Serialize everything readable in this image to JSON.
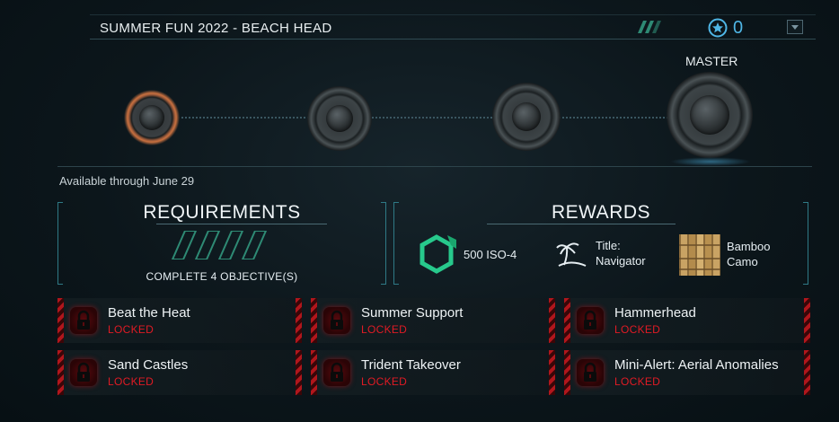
{
  "header": {
    "title": "SUMMER FUN 2022 - BEACH HEAD",
    "star_count": "0",
    "colors": {
      "accent": "#4fb6e6",
      "stripe": "#2e8a74"
    }
  },
  "tiers": {
    "master_label": "MASTER",
    "items": [
      {
        "name": "tier-1",
        "state": "active"
      },
      {
        "name": "tier-2",
        "state": "inactive"
      },
      {
        "name": "tier-3",
        "state": "inactive"
      },
      {
        "name": "tier-master",
        "state": "inactive"
      }
    ]
  },
  "availability": "Available through June 29",
  "requirements": {
    "title": "REQUIREMENTS",
    "objective_count": "COMPLETE 4 OBJECTIVE(S)",
    "progress_total": 4,
    "progress_done": 0
  },
  "rewards": {
    "title": "REWARDS",
    "items": [
      {
        "icon": "iso-crystal-icon",
        "line1": "500 ISO-4",
        "line2": ""
      },
      {
        "icon": "palm-island-icon",
        "line1": "Title:",
        "line2": "Navigator"
      },
      {
        "icon": "bamboo-camo-icon",
        "line1": "Bamboo",
        "line2": "Camo"
      }
    ]
  },
  "objectives": [
    {
      "name": "Beat the Heat",
      "status": "LOCKED"
    },
    {
      "name": "Summer Support",
      "status": "LOCKED"
    },
    {
      "name": "Hammerhead",
      "status": "LOCKED"
    },
    {
      "name": "Sand Castles",
      "status": "LOCKED"
    },
    {
      "name": "Trident Takeover",
      "status": "LOCKED"
    },
    {
      "name": "Mini-Alert: Aerial Anomalies",
      "status": "LOCKED"
    }
  ],
  "colors": {
    "locked": "#e01b24",
    "panel_bracket": "#2f7a86"
  }
}
